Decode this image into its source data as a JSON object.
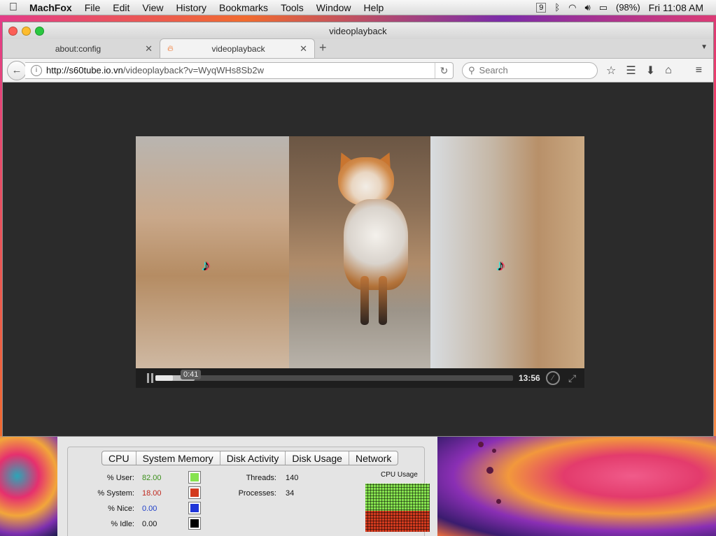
{
  "menubar": {
    "app": "MachFox",
    "items": [
      "File",
      "Edit",
      "View",
      "History",
      "Bookmarks",
      "Tools",
      "Window",
      "Help"
    ],
    "battery": "(98%)",
    "clock": "Fri 11:08 AM"
  },
  "window": {
    "title": "videoplayback",
    "tabs": [
      {
        "label": "about:config",
        "active": false
      },
      {
        "label": "videoplayback",
        "active": true
      }
    ],
    "url_host": "http://s60tube.io.vn",
    "url_path": "/videoplayback?v=WyqWHs8Sb2w",
    "search_placeholder": "Search"
  },
  "player": {
    "current_time": "0:41",
    "duration": "13:56",
    "progress_fraction": 0.049,
    "buffered_fraction": 0.11
  },
  "activity_monitor": {
    "tabs": [
      "CPU",
      "System Memory",
      "Disk Activity",
      "Disk Usage",
      "Network"
    ],
    "stats": [
      {
        "label": "% User:",
        "value": "82.00",
        "color": "#3a8f1a",
        "swatch": "#86e34f"
      },
      {
        "label": "% System:",
        "value": "18.00",
        "color": "#c0281e",
        "swatch": "#d33a1e"
      },
      {
        "label": "% Nice:",
        "value": "0.00",
        "color": "#1f3fc8",
        "swatch": "#1f35d8"
      },
      {
        "label": "% Idle:",
        "value": "0.00",
        "color": "#111111",
        "swatch": "#000000"
      }
    ],
    "threads_label": "Threads:",
    "threads": "140",
    "processes_label": "Processes:",
    "processes": "34",
    "graph_title": "CPU Usage"
  }
}
